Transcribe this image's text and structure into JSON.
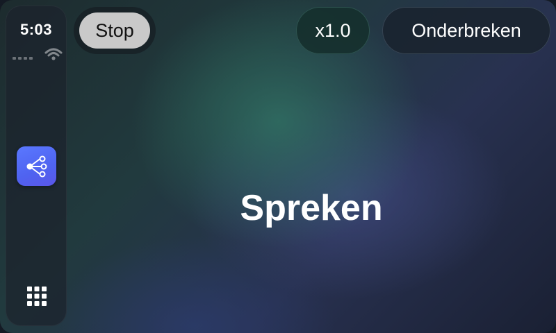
{
  "status_bar": {
    "time": "5:03",
    "signal_icon": "signal-bars-icon",
    "wifi_icon": "wifi-icon"
  },
  "sidebar": {
    "app_icon": "tree-branch-icon",
    "app_icon_color": "#5467F0",
    "launcher_icon": "app-grid-icon"
  },
  "toolbar": {
    "stop_label": "Stop",
    "speed_label": "x1.0",
    "interrupt_label": "Onderbreken"
  },
  "main": {
    "status_text": "Spreken"
  }
}
